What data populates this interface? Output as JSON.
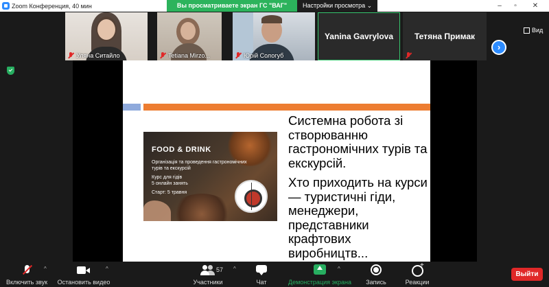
{
  "window": {
    "title": "Zoom Конференция, 40 мин"
  },
  "share_banner": {
    "message": "Вы просматриваете экран ГС \"ВАГ\"",
    "view_options": "Настройки просмотра ⌄"
  },
  "gallery": {
    "participants": [
      {
        "name": "Уляна Ситайло",
        "muted": true
      },
      {
        "name": "Tetiana Mirzo...",
        "muted": true
      },
      {
        "name": "Юрій Сологуб",
        "muted": true
      },
      {
        "name": "Yanina Gavrylova",
        "muted": false,
        "active_speaker": true
      },
      {
        "name": "Тетяна Примак",
        "muted": false
      }
    ],
    "next_page": "›",
    "view_label": "Вид"
  },
  "slide": {
    "promo": {
      "title": "FOOD & DRINK",
      "subtitle": "Організація та проведення гастрономічних турів та екскурсій",
      "course_line1": "Курс для гідів",
      "course_line2": "5 онлайн занять",
      "start": "Старт: 5 травня"
    },
    "paragraph1": "Системна робота зі створюванню гастрономічних турів та екскурсій.",
    "paragraph2": "Хто приходить на курси — туристичні гіди, менеджери, представники крафтових виробництв..."
  },
  "toolbar": {
    "audio_label": "Включить звук",
    "video_label": "Остановить видео",
    "participants_label": "Участники",
    "participants_count": "57",
    "chat_label": "Чат",
    "share_label": "Демонстрация экрана",
    "record_label": "Запись",
    "reactions_label": "Реакции",
    "leave_label": "Выйти",
    "caret": "^"
  },
  "colors": {
    "share_green": "#27ae60",
    "leave_red": "#e02828",
    "slide_bar_orange": "#ed7d31",
    "slide_bar_blue": "#8faadc",
    "next_blue": "#2d8cff"
  }
}
